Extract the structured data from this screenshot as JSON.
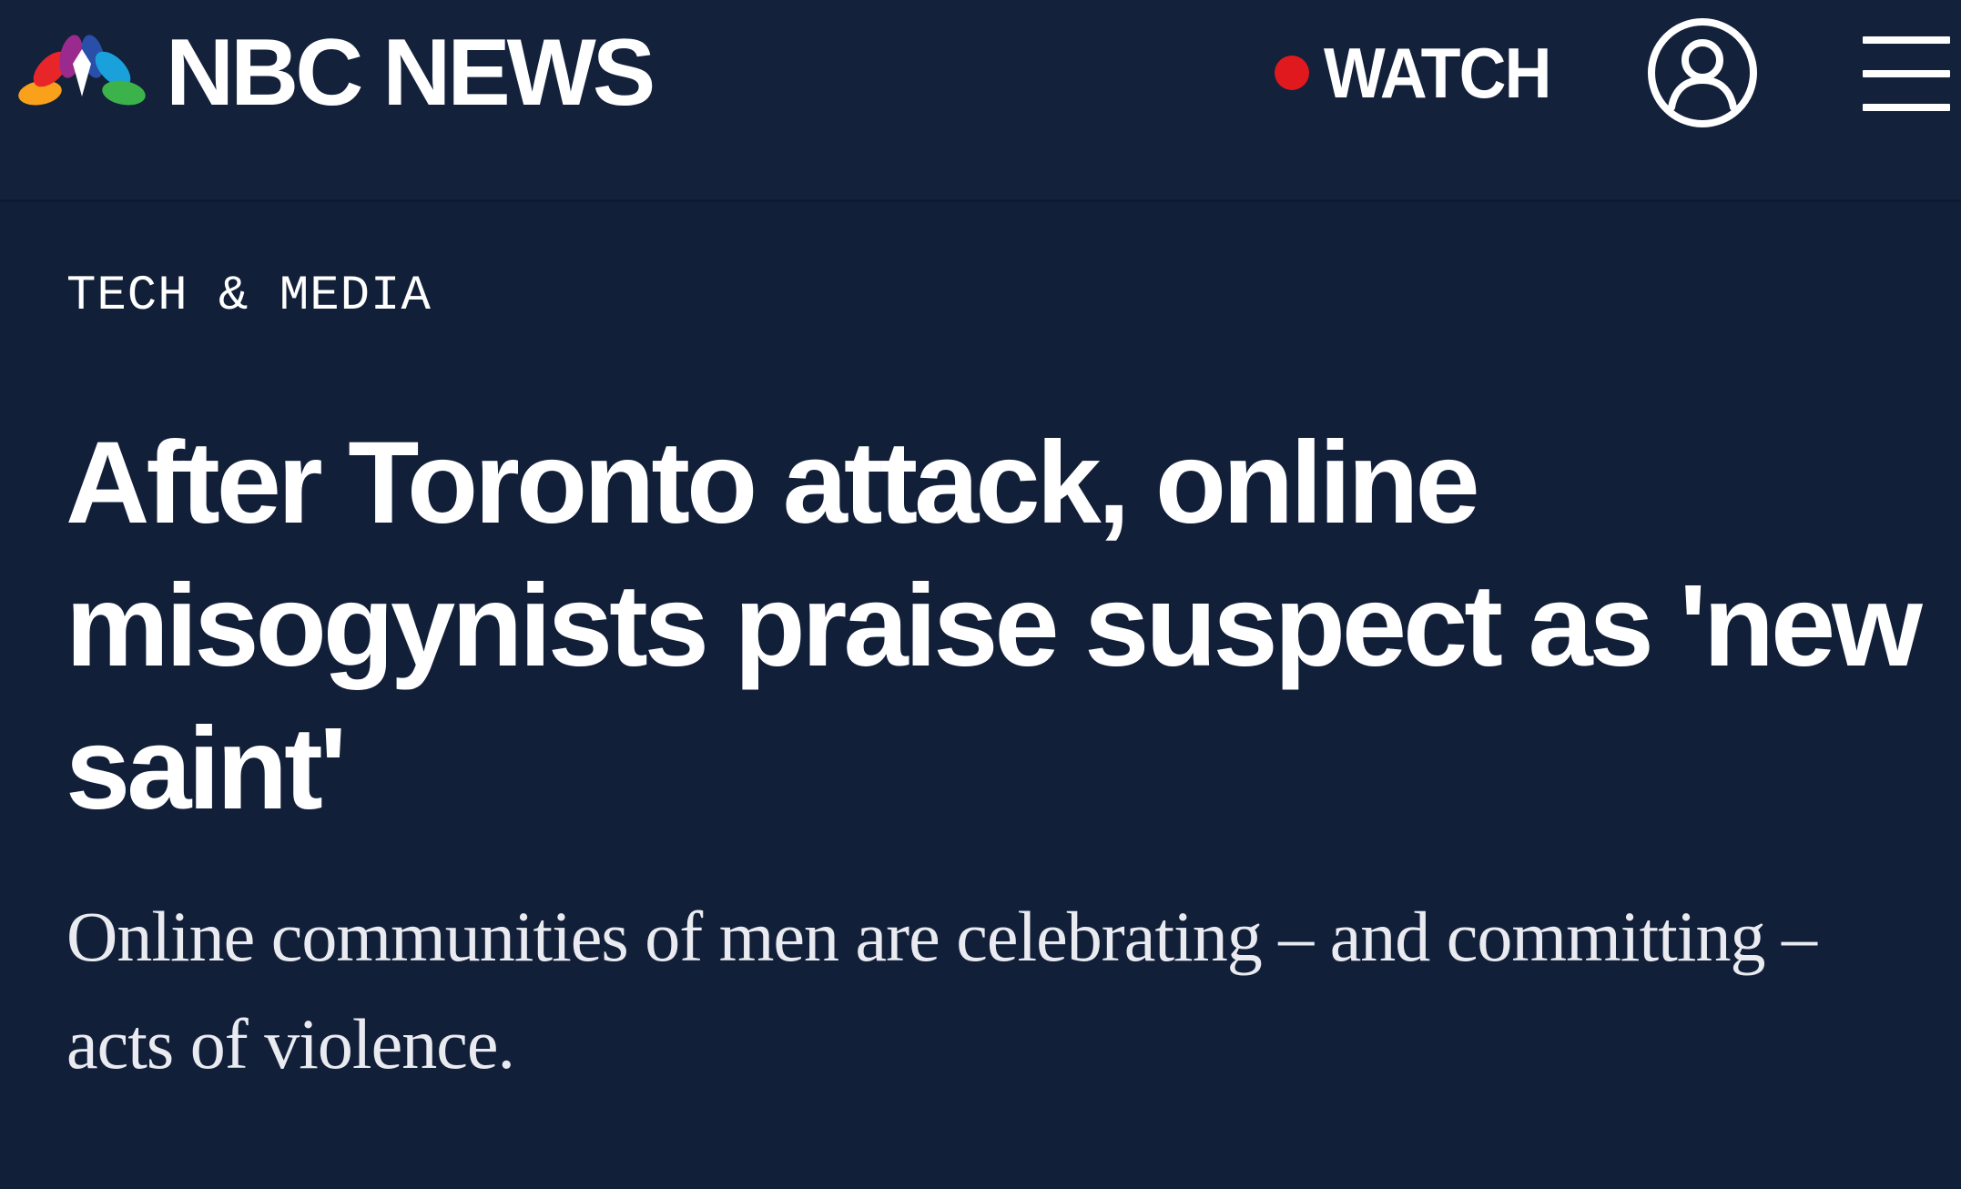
{
  "header": {
    "brand_name": "NBC NEWS",
    "logo_icon": "nbc-peacock-icon",
    "watch_label": "WATCH",
    "live_indicator_color": "#e0191e",
    "account_icon": "user-circle-icon",
    "menu_icon": "hamburger-menu-icon"
  },
  "article": {
    "category": "TECH & MEDIA",
    "headline": "After Toronto attack, online misogynists praise suspect as 'new saint'",
    "dek": "Online communities of men are celebrating – and committing – acts of violence."
  },
  "colors": {
    "background": "#121f39",
    "text": "#ffffff"
  }
}
